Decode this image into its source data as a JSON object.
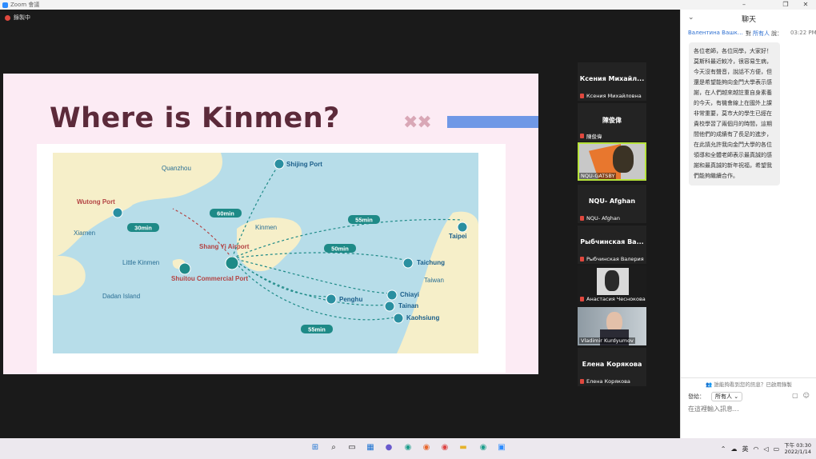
{
  "window": {
    "title": "Zoom 會議"
  },
  "meeting": {
    "recording_label": "錄製中"
  },
  "slide": {
    "title": "Where is Kinmen?",
    "map": {
      "places": [
        "Quanzhou",
        "Shijing Port",
        "Wutong Port",
        "Xiamen",
        "Kinmen",
        "Shang Yi Airport",
        "Taipei",
        "Little Kinmen",
        "Shuitou Commercial Port",
        "Taichung",
        "Taiwan",
        "Dadan Island",
        "Chiayi",
        "Penghu",
        "Tainan",
        "Kaohsiung"
      ],
      "durations": [
        "60min",
        "55min",
        "30min",
        "50min",
        "55min"
      ]
    }
  },
  "participants": [
    {
      "display": "Ксения Михайл...",
      "name": "Ксения Михайловна",
      "muted": true,
      "video": false
    },
    {
      "display": "陳俊偉",
      "name": "陳俊偉",
      "muted": true,
      "video": false
    },
    {
      "display": "",
      "name": "NQU-GATSBY",
      "muted": false,
      "video": true,
      "active": true
    },
    {
      "display": "NQU- Afghan",
      "name": "NQU- Afghan",
      "muted": true,
      "video": false
    },
    {
      "display": "Рыбчинская Ва...",
      "name": "Рыбчинская Валерия",
      "muted": true,
      "video": false
    },
    {
      "display": "",
      "name": "Анастасия Чеснокова",
      "muted": true,
      "video": true
    },
    {
      "display": "",
      "name": "Vladimir Kurdyumov",
      "muted": false,
      "video": true
    },
    {
      "display": "Елена Корякова",
      "name": "Елена Корякова",
      "muted": true,
      "video": false
    }
  ],
  "chat": {
    "title": "聊天",
    "message": {
      "sender": "Валентина Вашкяви...",
      "to": "對",
      "recipient": "所有人",
      "said": "說：",
      "time": "03:22 PM",
      "text": "各位老師，各位同學，大家好！莫斯科最近較冷，很容易生病，今天沒有聲音，說話不方便，但還是希望能夠向金門大學表示感謝，在人們越來越註重自身素養的今天，有機會線上在國外上課非常重要，莫市大的學生已經在貴校學習了兩個月的時間，這期間他們的成績有了長足的進步，在此請允許我向金門大學的各位領導和全體老師表示最真誠的感謝和最真誠的新年祝福，希望我們能夠繼續合作。"
    },
    "notice": "誰能夠看到您的訊息？已啟用錄製",
    "send_to_label": "發給：",
    "send_to_value": "所有人",
    "input_placeholder": "在這裡輸入訊息..."
  },
  "taskbar": {
    "ime": "英",
    "time": "下午 03:30",
    "date": "2022/1/14"
  }
}
